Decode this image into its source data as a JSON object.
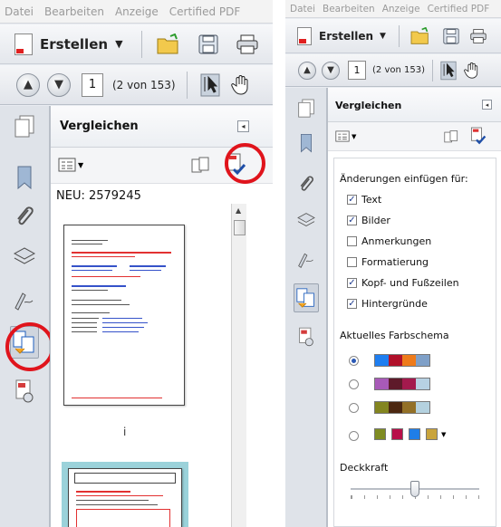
{
  "menu": [
    "Datei",
    "Bearbeiten",
    "Anzeige",
    "Certified PDF"
  ],
  "toolbar": {
    "create_label": "Erstellen",
    "page_current": "1",
    "page_count": "(2 von 153)"
  },
  "panel": {
    "title": "Vergleichen",
    "new_label": "NEU: 2579245",
    "thumb_caption": "i"
  },
  "options": {
    "section1_title": "Änderungen einfügen für:",
    "checks": [
      {
        "label": "Text",
        "checked": "✓"
      },
      {
        "label": "Bilder",
        "checked": "✓"
      },
      {
        "label": "Anmerkungen",
        "checked": ""
      },
      {
        "label": "Formatierung",
        "checked": ""
      },
      {
        "label": "Kopf- und Fußzeilen",
        "checked": "✓"
      },
      {
        "label": "Hintergründe",
        "checked": "✓"
      }
    ],
    "section2_title": "Aktuelles Farbschema",
    "color_schemes": [
      [
        "#1e7ef0",
        "#b0102a",
        "#ee7b1b",
        "#7fa0c8"
      ],
      [
        "#a85ab8",
        "#5e1a2a",
        "#a31a4d",
        "#b7d1e3"
      ],
      [
        "#83851f",
        "#4b2710",
        "#937027",
        "#b4d1df"
      ],
      [
        "#7f8c22",
        "#b80f4a",
        "#1f7ee8",
        "#c9a43c"
      ]
    ],
    "opacity_label": "Deckkraft"
  }
}
